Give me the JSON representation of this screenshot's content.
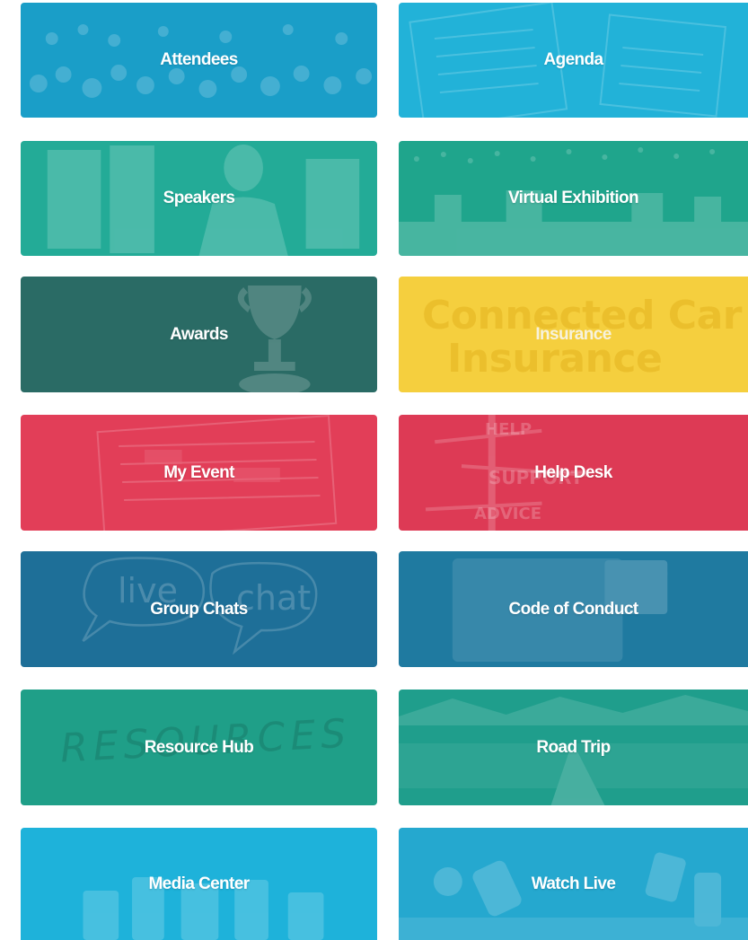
{
  "tiles": {
    "attendees": {
      "label": "Attendees",
      "color": "#1a9ec8"
    },
    "agenda": {
      "label": "Agenda",
      "color": "#22b2d8"
    },
    "speakers": {
      "label": "Speakers",
      "color": "#23ab97"
    },
    "virtual_exhibition": {
      "label": "Virtual Exhibition",
      "color": "#1fa58c"
    },
    "awards": {
      "label": "Awards",
      "color": "#2a6b65"
    },
    "insurance": {
      "label": "Insurance",
      "color": "#f5cf3e",
      "watermark_line1": "Connected Car",
      "watermark_line2": "Insurance"
    },
    "my_event": {
      "label": "My Event",
      "color": "#e23e58"
    },
    "help_desk": {
      "label": "Help Desk",
      "color": "#dd3a55",
      "sign_help": "HELP",
      "sign_support": "SUPPORT",
      "sign_advice": "ADVICE"
    },
    "group_chats": {
      "label": "Group Chats",
      "color": "#1e6f98",
      "bubble_live": "live",
      "bubble_chat": "chat"
    },
    "code_of_conduct": {
      "label": "Code of Conduct",
      "color": "#1f7aa0"
    },
    "resource_hub": {
      "label": "Resource Hub",
      "color": "#1f9f88",
      "watermark": "RESOURCES"
    },
    "road_trip": {
      "label": "Road Trip",
      "color": "#1f9e8c"
    },
    "media_center": {
      "label": "Media Center",
      "color": "#1eb2da"
    },
    "watch_live": {
      "label": "Watch Live",
      "color": "#25a8cf"
    }
  },
  "icons": {
    "trophy": "trophy-icon",
    "camera": "camera-icon"
  }
}
